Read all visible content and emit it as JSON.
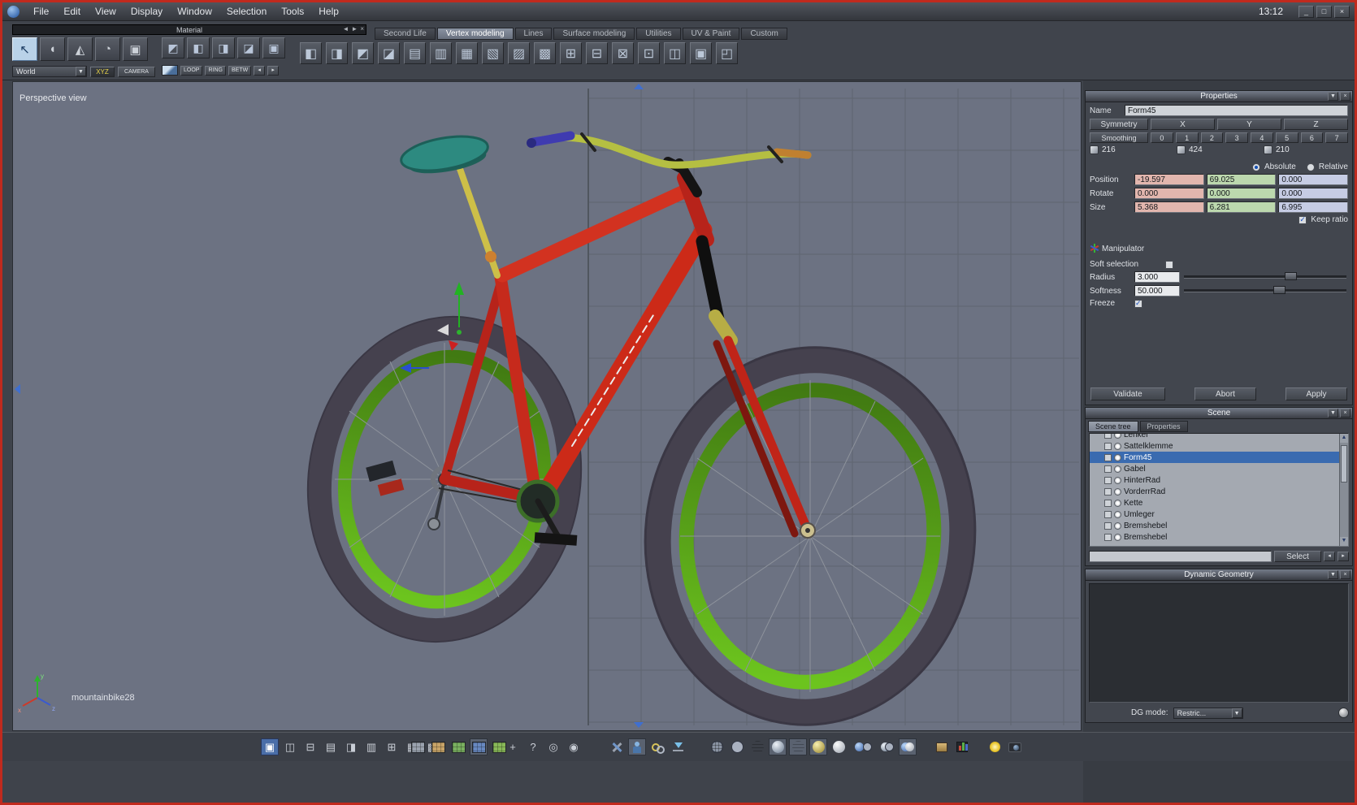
{
  "window": {
    "time": "13:12"
  },
  "menu": {
    "items": [
      "File",
      "Edit",
      "View",
      "Display",
      "Window",
      "Selection",
      "Tools",
      "Help"
    ]
  },
  "material_bar": {
    "title": "Material",
    "world": "World",
    "xyz": "XYZ",
    "camera": "CAMERA",
    "loop": "LOOP",
    "ring": "RING",
    "betw": "BETW"
  },
  "tabs": {
    "items": [
      {
        "label": "Second Life"
      },
      {
        "label": "Vertex modeling"
      },
      {
        "label": "Lines"
      },
      {
        "label": "Surface modeling"
      },
      {
        "label": "Utilities"
      },
      {
        "label": "UV & Paint"
      },
      {
        "label": "Custom"
      }
    ]
  },
  "viewport": {
    "label": "Perspective view",
    "model_name": "mountainbike28"
  },
  "properties": {
    "title": "Properties",
    "name_label": "Name",
    "name_value": "Form45",
    "symmetry": "Symmetry",
    "axes": [
      "X",
      "Y",
      "Z"
    ],
    "smoothing": "Smoothing",
    "levels": [
      "0",
      "1",
      "2",
      "3",
      "4",
      "5",
      "6",
      "7"
    ],
    "counts": [
      {
        "value": "216"
      },
      {
        "value": "424"
      },
      {
        "value": "210"
      }
    ],
    "absolute": "Absolute",
    "relative": "Relative",
    "position_label": "Position",
    "rotate_label": "Rotate",
    "size_label": "Size",
    "position": [
      "-19.597",
      "69.025",
      "0.000"
    ],
    "rotate": [
      "0.000",
      "0.000",
      "0.000"
    ],
    "size": [
      "5.368",
      "6.281",
      "6.995"
    ],
    "keep_ratio": "Keep ratio",
    "manipulator": "Manipulator",
    "soft_selection": "Soft selection",
    "radius_label": "Radius",
    "radius": "3.000",
    "softness_label": "Softness",
    "softness": "50.000",
    "freeze": "Freeze",
    "validate": "Validate",
    "abort": "Abort",
    "apply": "Apply"
  },
  "scene": {
    "title": "Scene",
    "tab_tree": "Scene tree",
    "tab_props": "Properties",
    "items": [
      {
        "label": "Lenker"
      },
      {
        "label": "Sattelklemme"
      },
      {
        "label": "Form45"
      },
      {
        "label": "Gabel"
      },
      {
        "label": "HinterRad"
      },
      {
        "label": "VorderrRad"
      },
      {
        "label": "Kette"
      },
      {
        "label": "Umleger"
      },
      {
        "label": "Bremshebel"
      },
      {
        "label": "Bremshebel"
      }
    ],
    "select": "Select"
  },
  "dynamic_geometry": {
    "title": "Dynamic Geometry",
    "dg_mode_label": "DG mode:",
    "dg_mode_value": "Restric..."
  },
  "icons": {
    "close": "×",
    "collapse": "▼",
    "dropdown": "▼",
    "minimize": "_",
    "maximize": "□",
    "arrow_left": "◄",
    "arrow_right": "►",
    "scroll_up": "▲",
    "scroll_down": "▼",
    "left_tools": [
      "↖",
      "◖",
      "◭",
      "◔",
      "▣"
    ],
    "select_modes": [
      "◩",
      "◧",
      "◨",
      "◪",
      "▣"
    ],
    "ribbon": [
      "◧",
      "◨",
      "◩",
      "◪",
      "▤",
      "▥",
      "▦",
      "▧",
      "▨",
      "▩",
      "⊞",
      "⊟",
      "⊠",
      "⊡",
      "◫",
      "▣",
      "◰"
    ],
    "layouts": [
      "▣",
      "◫",
      "⊟",
      "▤",
      "◨",
      "▥",
      "⊞",
      "▦",
      "▩"
    ],
    "view_tools": [
      "+",
      "?",
      "◎",
      "◉"
    ],
    "nav_small": [
      "◂",
      "▸"
    ]
  }
}
